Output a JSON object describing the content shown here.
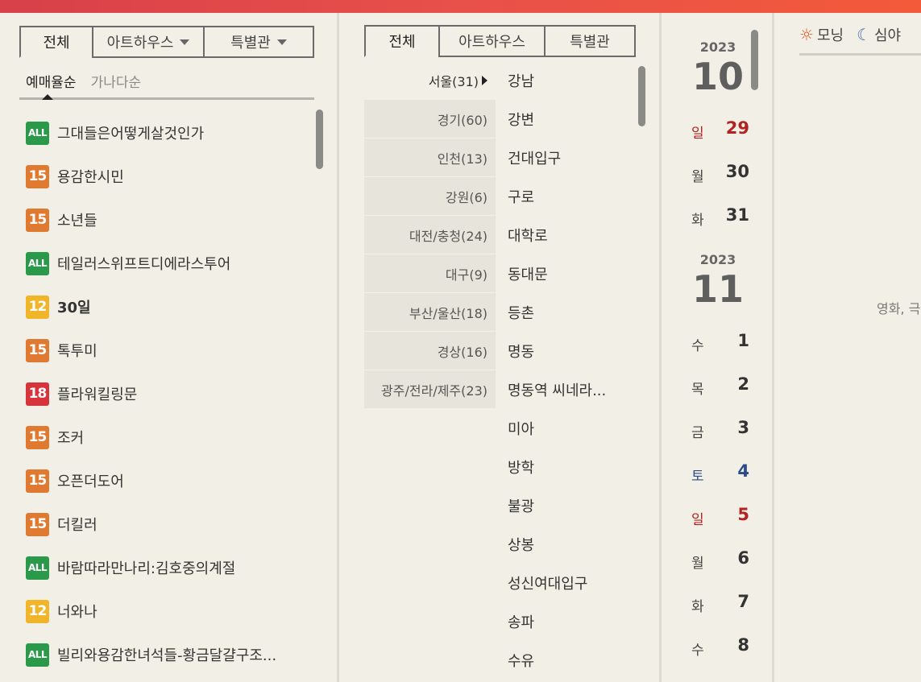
{
  "movie": {
    "tabs": [
      "전체",
      "아트하우스",
      "특별관"
    ],
    "sort": {
      "active": "예매율순",
      "other": "가나다순"
    },
    "list": [
      {
        "rating": "ALL",
        "color": "#2a9a4a",
        "title": "그대들은어떻게살것인가"
      },
      {
        "rating": "15",
        "color": "#e07a30",
        "title": "용감한시민"
      },
      {
        "rating": "15",
        "color": "#e07a30",
        "title": "소년들"
      },
      {
        "rating": "ALL",
        "color": "#2a9a4a",
        "title": "테일러스위프트디에라스투어"
      },
      {
        "rating": "12",
        "color": "#f0b528",
        "title": "30일",
        "bold": true
      },
      {
        "rating": "15",
        "color": "#e07a30",
        "title": "톡투미"
      },
      {
        "rating": "18",
        "color": "#d8333a",
        "title": "플라워킬링문"
      },
      {
        "rating": "15",
        "color": "#e07a30",
        "title": "조커"
      },
      {
        "rating": "15",
        "color": "#e07a30",
        "title": "오픈더도어"
      },
      {
        "rating": "15",
        "color": "#e07a30",
        "title": "더킬러"
      },
      {
        "rating": "ALL",
        "color": "#2a9a4a",
        "title": "바람따라만나리:김호중의계절"
      },
      {
        "rating": "12",
        "color": "#f0b528",
        "title": "너와나"
      },
      {
        "rating": "ALL",
        "color": "#2a9a4a",
        "title": "빌리와용감한녀석들-황금달걀구조..."
      }
    ]
  },
  "theater": {
    "tabs": [
      "전체",
      "아트하우스",
      "특별관"
    ],
    "regions": [
      "서울(31)",
      "경기(60)",
      "인천(13)",
      "강원(6)",
      "대전/충청(24)",
      "대구(9)",
      "부산/울산(18)",
      "경상(16)",
      "광주/전라/제주(23)"
    ],
    "theaters": [
      "강남",
      "강변",
      "건대입구",
      "구로",
      "대학로",
      "동대문",
      "등촌",
      "명동",
      "명동역 씨네라...",
      "미아",
      "방학",
      "불광",
      "상봉",
      "성신여대입구",
      "송파",
      "수유"
    ]
  },
  "dates": {
    "oct": {
      "year": "2023",
      "month": "10"
    },
    "nov": {
      "year": "2023",
      "month": "11"
    },
    "days": [
      {
        "wd": "일",
        "d": "29",
        "type": "sun"
      },
      {
        "wd": "월",
        "d": "30",
        "type": ""
      },
      {
        "wd": "화",
        "d": "31",
        "type": ""
      },
      {
        "wd": "수",
        "d": "1",
        "type": ""
      },
      {
        "wd": "목",
        "d": "2",
        "type": ""
      },
      {
        "wd": "금",
        "d": "3",
        "type": ""
      },
      {
        "wd": "토",
        "d": "4",
        "type": "sat"
      },
      {
        "wd": "일",
        "d": "5",
        "type": "sun"
      },
      {
        "wd": "월",
        "d": "6",
        "type": ""
      },
      {
        "wd": "화",
        "d": "7",
        "type": ""
      },
      {
        "wd": "수",
        "d": "8",
        "type": ""
      }
    ]
  },
  "time": {
    "morning": "모닝",
    "night": "심야",
    "note": "영화, 극"
  }
}
